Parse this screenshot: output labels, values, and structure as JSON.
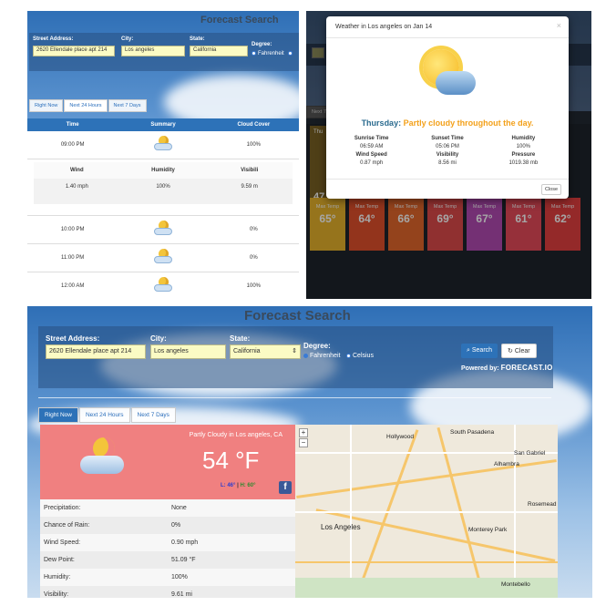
{
  "app": {
    "title": "Forecast Search",
    "powered_by": "Powered by:",
    "powered_brand": "FORECAST.IO"
  },
  "form": {
    "street_label": "Street Address:",
    "street_value": "2620 Ellendale place apt 214",
    "city_label": "City:",
    "city_value": "Los angeles",
    "state_label": "State:",
    "state_value": "California",
    "degree_label": "Degree:",
    "degree_options": [
      "Fahrenheit",
      "Celsius"
    ],
    "search_label": "Search",
    "clear_label": "Clear"
  },
  "tabs": [
    "Right Now",
    "Next 24 Hours",
    "Next 7 Days"
  ],
  "hourly": {
    "headers": [
      "Time",
      "Summary",
      "Cloud Cover"
    ],
    "detail_headers": [
      "Wind",
      "Humidity",
      "Visibili"
    ],
    "detail_values": [
      "1.40 mph",
      "100%",
      "9.59 m"
    ],
    "rows": [
      {
        "time": "09:00 PM",
        "cloud": "100%"
      },
      {
        "time": "10:00 PM",
        "cloud": "0%"
      },
      {
        "time": "11:00 PM",
        "cloud": "0%"
      },
      {
        "time": "12:00 AM",
        "cloud": "100%"
      }
    ]
  },
  "modal": {
    "title": "Weather in Los angeles on Jan 14",
    "close_x": "×",
    "day": "Thursday:",
    "summary": "Partly cloudy throughout the day.",
    "grid": [
      [
        "Sunrise Time",
        "Sunset Time",
        "Humidity"
      ],
      [
        "06:59 AM",
        "05:06 PM",
        "100%"
      ],
      [
        "Wind Speed",
        "Visibility",
        "Pressure"
      ],
      [
        "0.87 mph",
        "8.56 mi",
        "1019.38 mb"
      ]
    ],
    "close_button": "Close"
  },
  "weekly": {
    "tab_fragment": "Next 7",
    "side_fragment_top": "Thu",
    "side_fragment_num": "47",
    "label": "Max Temp",
    "cards": [
      {
        "temp": "65°",
        "color": "#e6b32b"
      },
      {
        "temp": "64°",
        "color": "#e2502b"
      },
      {
        "temp": "66°",
        "color": "#e3682c"
      },
      {
        "temp": "69°",
        "color": "#dd4b4b"
      },
      {
        "temp": "67°",
        "color": "#b34bb3"
      },
      {
        "temp": "61°",
        "color": "#e64b5a"
      },
      {
        "temp": "62°",
        "color": "#e34040"
      }
    ]
  },
  "now": {
    "summary": "Partly Cloudy in Los angeles, CA",
    "temp": "54 °F",
    "low": "L: 46°",
    "high": "H: 60°",
    "separator": "|",
    "fb": "f",
    "rows": [
      {
        "label": "Precipitation:",
        "value": "None"
      },
      {
        "label": "Chance of Rain:",
        "value": "0%"
      },
      {
        "label": "Wind Speed:",
        "value": "0.90 mph"
      },
      {
        "label": "Dew Point:",
        "value": "51.09 °F"
      },
      {
        "label": "Humidity:",
        "value": "100%"
      },
      {
        "label": "Visibility:",
        "value": "9.61 mi"
      }
    ]
  },
  "map": {
    "zoom_in": "+",
    "zoom_out": "−",
    "labels": [
      "South Pasadena",
      "San Gabriel",
      "Alhambra",
      "Los Angeles",
      "Monterey Park",
      "Rosemead",
      "Montebello",
      "Hollywood"
    ]
  },
  "colors": {
    "accent": "#2d72b8",
    "now_card": "#f08080",
    "summary_orange": "#f3a11b"
  }
}
